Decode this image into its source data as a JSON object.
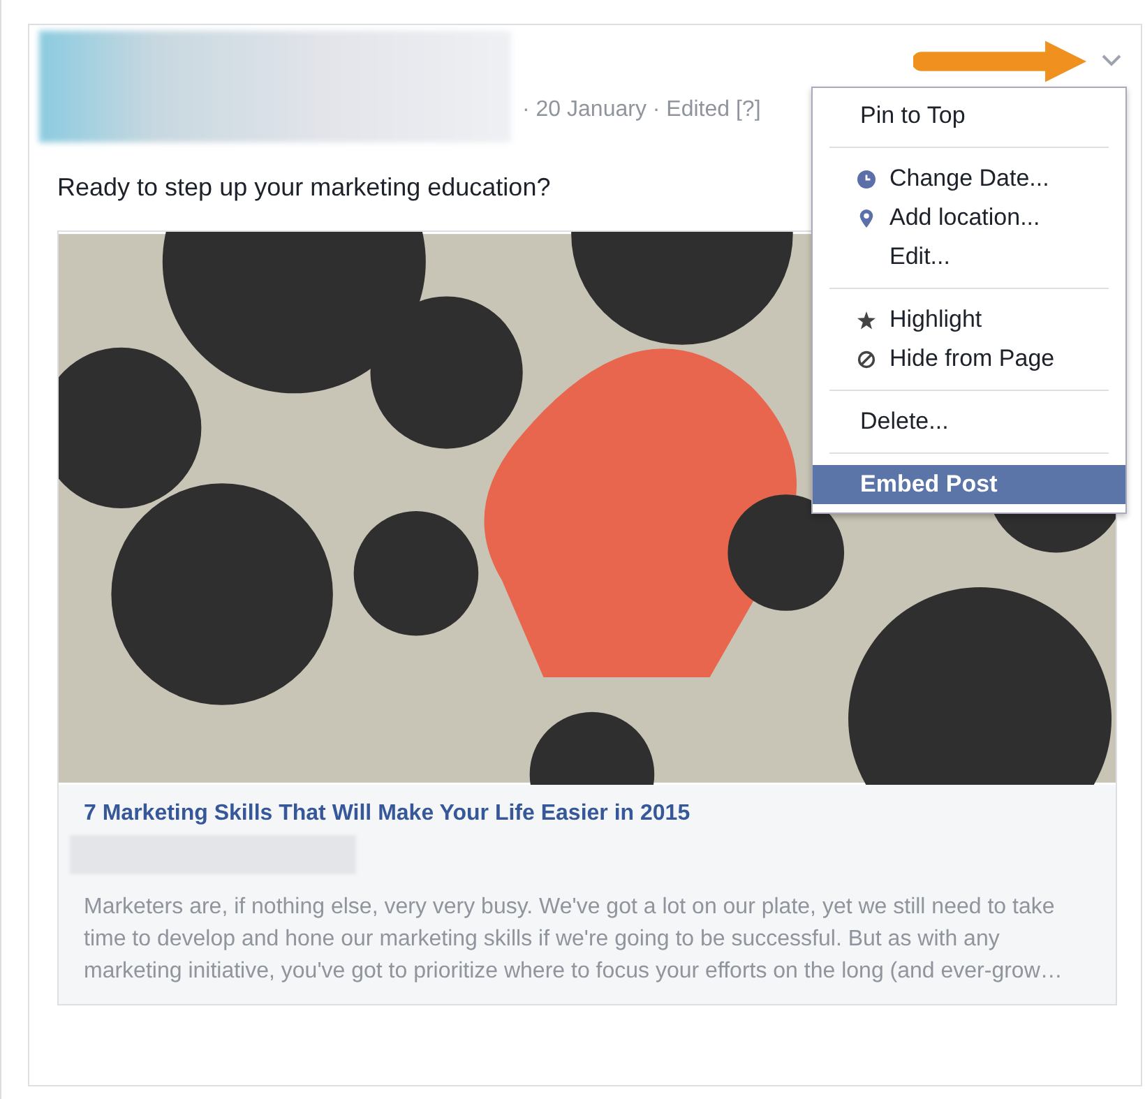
{
  "post": {
    "meta": "· 20 January · Edited [?]",
    "text": "Ready to step up your marketing education?"
  },
  "link": {
    "title": "7 Marketing Skills That Will Make Your Life Easier in 2015",
    "description": "Marketers are, if nothing else, very very busy. We've got a lot on our plate, yet we still need to take time to develop and hone our marketing skills if we're going to be successful. But as with any marketing initiative, you've got to prioritize where to focus your efforts on the long (and ever-grow…"
  },
  "menu": {
    "groups": [
      [
        {
          "label": "Pin to Top",
          "kind": "plain",
          "selected": false
        }
      ],
      [
        {
          "label": "Change Date...",
          "kind": "clock",
          "selected": false
        },
        {
          "label": "Add location...",
          "kind": "pin",
          "selected": false
        },
        {
          "label": "Edit...",
          "kind": "plain",
          "selected": false
        }
      ],
      [
        {
          "label": "Highlight",
          "kind": "star",
          "selected": false
        },
        {
          "label": "Hide from Page",
          "kind": "ban",
          "selected": false
        }
      ],
      [
        {
          "label": "Delete...",
          "kind": "plain",
          "selected": false
        }
      ],
      [
        {
          "label": "Embed Post",
          "kind": "plain",
          "selected": true
        }
      ]
    ]
  }
}
